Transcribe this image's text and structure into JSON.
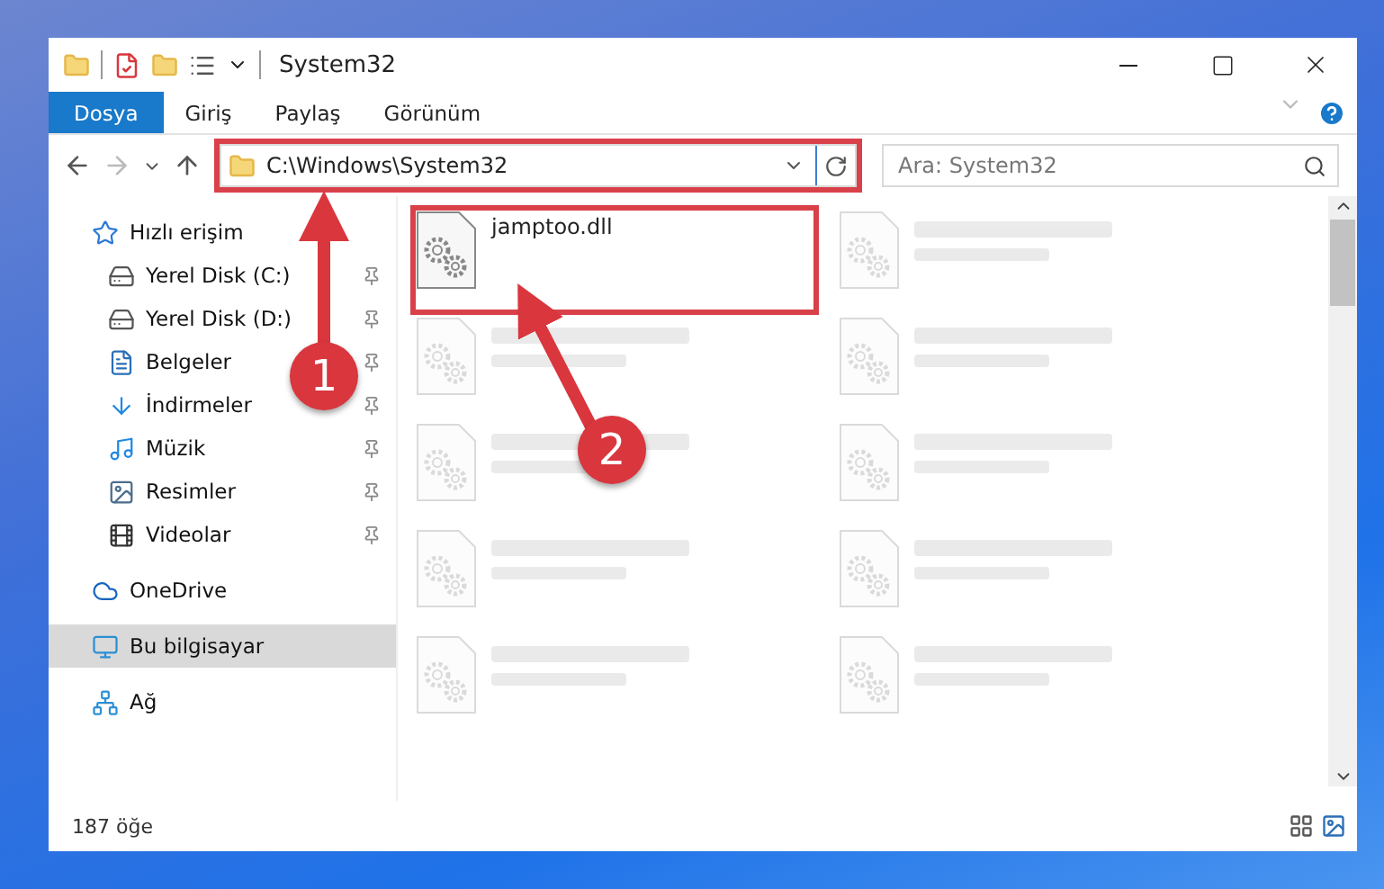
{
  "window": {
    "title": "System32"
  },
  "ribbon_tabs": [
    {
      "label": "Dosya",
      "selected": true
    },
    {
      "label": "Giriş",
      "selected": false
    },
    {
      "label": "Paylaş",
      "selected": false
    },
    {
      "label": "Görünüm",
      "selected": false
    }
  ],
  "address_bar": {
    "path": "C:\\Windows\\System32",
    "highlighted": true
  },
  "search": {
    "placeholder": "Ara: System32"
  },
  "sidebar": {
    "items": [
      {
        "label": "Hızlı erişim",
        "kind": "star",
        "selected": false,
        "children": [
          {
            "label": "Yerel Disk (C:)",
            "kind": "disk",
            "pinned": true,
            "selected": false
          },
          {
            "label": "Yerel Disk (D:)",
            "kind": "disk",
            "pinned": true,
            "selected": false
          },
          {
            "label": "Belgeler",
            "kind": "doc",
            "pinned": true,
            "selected": false
          },
          {
            "label": "İndirmeler",
            "kind": "download",
            "pinned": true,
            "selected": false
          },
          {
            "label": "Müzik",
            "kind": "music",
            "pinned": true,
            "selected": false
          },
          {
            "label": "Resimler",
            "kind": "image",
            "pinned": true,
            "selected": false
          },
          {
            "label": "Videolar",
            "kind": "film",
            "pinned": true,
            "selected": false
          }
        ]
      },
      {
        "label": "OneDrive",
        "kind": "cloud",
        "selected": false
      },
      {
        "label": "Bu bilgisayar",
        "kind": "monitor",
        "selected": true
      },
      {
        "label": "Ağ",
        "kind": "network",
        "selected": false
      }
    ]
  },
  "files": [
    {
      "kind": "file",
      "name": "jamptoo.dll",
      "highlighted": true
    },
    {
      "kind": "blurred",
      "highlighted": false
    },
    {
      "kind": "blurred",
      "highlighted": false
    },
    {
      "kind": "blurred",
      "highlighted": false
    },
    {
      "kind": "blurred",
      "highlighted": false
    },
    {
      "kind": "blurred",
      "highlighted": false
    },
    {
      "kind": "blurred",
      "highlighted": false
    },
    {
      "kind": "blurred",
      "highlighted": false
    },
    {
      "kind": "blurred",
      "highlighted": false
    },
    {
      "kind": "blurred",
      "highlighted": false
    }
  ],
  "status_bar": {
    "count": "187 öğe"
  },
  "annotations": [
    {
      "number": "1"
    },
    {
      "number": "2"
    }
  ]
}
